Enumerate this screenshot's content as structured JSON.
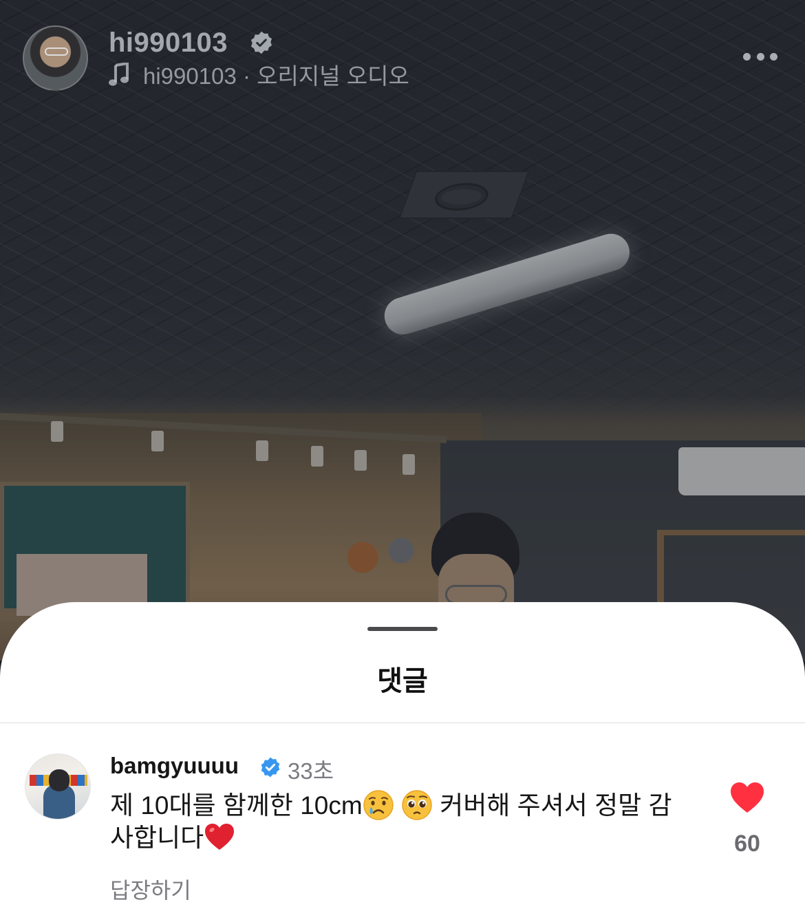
{
  "post": {
    "username": "hi990103",
    "audio_label": "hi990103 · 오리지널 오디오"
  },
  "comments_sheet": {
    "title": "댓글",
    "comment": {
      "username": "bamgyuuuu",
      "time": "33초",
      "text_part1": "제 10대를 함께한 10cm",
      "text_part2": " 커버해 주셔서 정말 감사합니다",
      "emojis": [
        "crying-face-emoji",
        "pleading-face-emoji",
        "red-heart-emoji"
      ],
      "reply_label": "답장하기",
      "like_count": "60"
    }
  },
  "colors": {
    "verified": "#3797f0",
    "heart": "#ff3040",
    "muted_text": "#7b7b80"
  }
}
